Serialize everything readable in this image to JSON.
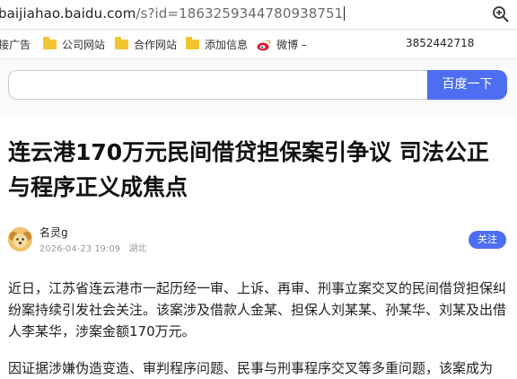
{
  "browser": {
    "url_host": "baijiahao.baidu.com",
    "url_path": "/s?id=1863259344780938751"
  },
  "bookmarks": {
    "items": [
      {
        "label": "接广告"
      },
      {
        "label": "公司网站"
      },
      {
        "label": "合作网站"
      },
      {
        "label": "添加信息"
      },
      {
        "label": "微博 –"
      }
    ],
    "number": "3852442718"
  },
  "search": {
    "input_value": "",
    "button_label": "百度一下"
  },
  "article": {
    "title": "连云港170万元民间借贷担保案引争议 司法公正与程序正义成焦点",
    "author": "名灵g",
    "date": "2026-04-23 19:09",
    "location": "湖北",
    "follow_label": "关注",
    "paragraphs": [
      "近日，江苏省连云港市一起历经一审、上诉、再审、刑事立案交叉的民间借贷担保纠纷案持续引发社会关注。该案涉及借款人金某、担保人刘某某、孙某华、刘某及出借人李某华，涉案金额170万元。",
      "因证据涉嫌伪造变造、审判程序问题、民事与刑事程序交叉等多重问题，该案成为"
    ]
  },
  "colors": {
    "accent": "#4e6ef2",
    "folder": "#f4c430"
  }
}
